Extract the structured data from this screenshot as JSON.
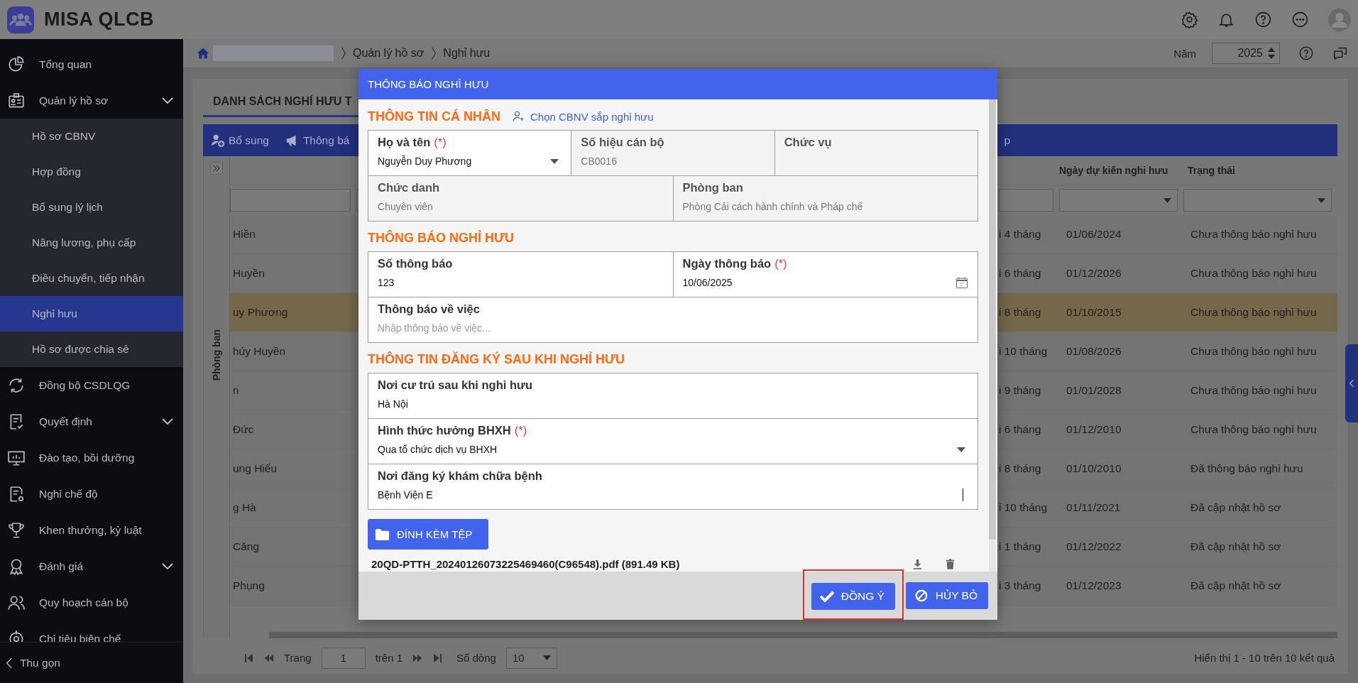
{
  "app": {
    "title": "MISA QLCB"
  },
  "sidebar": {
    "items": [
      {
        "label": "Tổng quan",
        "selected": false
      },
      {
        "label": "Quản lý hồ sơ",
        "selected": false,
        "expandable": true,
        "expanded": true,
        "children": [
          {
            "label": "Hồ sơ CBNV",
            "selected": false
          },
          {
            "label": "Hợp đồng",
            "selected": false
          },
          {
            "label": "Bổ sung lý lịch",
            "selected": false
          },
          {
            "label": "Nâng lương, phụ cấp",
            "selected": false
          },
          {
            "label": "Điều chuyển, tiếp nhận",
            "selected": false
          },
          {
            "label": "Nghỉ hưu",
            "selected": true
          },
          {
            "label": "Hồ sơ được chia sẻ",
            "selected": false
          }
        ]
      },
      {
        "label": "Đồng bộ CSDLQG",
        "selected": false
      },
      {
        "label": "Quyết định",
        "selected": false,
        "expandable": true
      },
      {
        "label": "Đào tạo, bồi dưỡng",
        "selected": false
      },
      {
        "label": "Nghỉ chế độ",
        "selected": false
      },
      {
        "label": "Khen thưởng, kỷ luật",
        "selected": false
      },
      {
        "label": "Đánh giá",
        "selected": false,
        "expandable": true
      },
      {
        "label": "Quy hoạch cán bộ",
        "selected": false
      },
      {
        "label": "Chỉ tiêu biên chế",
        "selected": false
      }
    ],
    "collapse_label": "Thu gọn"
  },
  "breadcrumb": {
    "items": [
      "Quản lý hồ sơ",
      "Nghỉ hưu"
    ]
  },
  "year": {
    "label": "Năm",
    "value": "2025"
  },
  "tab": {
    "label": "DANH SÁCH NGHỈ HƯU T"
  },
  "toolbar": {
    "items": [
      "Bổ sung",
      "Thông bá"
    ],
    "tail": "p"
  },
  "table": {
    "side_panel": "Phòng ban",
    "headers": {
      "retire_date": "Ngày dự kiến nghỉ hưu",
      "status": "Trạng thái"
    },
    "rows": [
      {
        "column_1": "Hiền",
        "column_4": "i 4 tháng",
        "retire_date": "01/06/2024",
        "status": "Chưa thông báo nghỉ hưu",
        "selected": false
      },
      {
        "column_1": "Huyền",
        "column_4": "i 6 tháng",
        "retire_date": "01/12/2026",
        "status": "Chưa thông báo nghỉ hưu",
        "selected": false
      },
      {
        "column_1": "uy Phương",
        "column_4": "i 8 tháng",
        "retire_date": "01/10/2015",
        "status": "Chưa thông báo nghỉ hưu",
        "selected": true
      },
      {
        "column_1": "húy Huyền",
        "column_4": "i 10 tháng",
        "retire_date": "01/08/2026",
        "status": "Chưa thông báo nghỉ hưu",
        "selected": false
      },
      {
        "column_1": "n",
        "column_4": "i 9 tháng",
        "retire_date": "01/01/2028",
        "status": "Chưa thông báo nghỉ hưu",
        "selected": false
      },
      {
        "column_1": "Đức",
        "column_4": "i 6 tháng",
        "retire_date": "01/12/2010",
        "status": "Chưa thông báo nghỉ hưu",
        "selected": false
      },
      {
        "column_1": "ung Hiếu",
        "column_4": "i 8 tháng",
        "retire_date": "01/10/2010",
        "status": "Đã thông báo nghỉ hưu",
        "selected": false
      },
      {
        "column_1": "g Hà",
        "column_4": "i 10 tháng",
        "retire_date": "01/11/2021",
        "status": "Đã cập nhật hồ sơ",
        "selected": false
      },
      {
        "column_1": "Căng",
        "column_4": "i 1 tháng",
        "retire_date": "01/12/2022",
        "status": "Đã cập nhật hồ sơ",
        "selected": false
      },
      {
        "column_1": "Phụng",
        "column_4": "i 3 tháng",
        "retire_date": "01/12/2023",
        "status": "Đã cập nhật hồ sơ",
        "selected": false
      }
    ]
  },
  "pager": {
    "page_label": "Trang",
    "page": "1",
    "of": "trên 1",
    "rows_label": "Số dòng",
    "rows": "10",
    "summary": "Hiển thị 1 - 10 trên 10 kết quả"
  },
  "dialog": {
    "title": "THÔNG BÁO NGHỈ HƯU",
    "sections": [
      {
        "title": "THÔNG TIN CÁ NHÂN",
        "action": "Chọn CBNV sắp nghỉ hưu",
        "rows": [
          {
            "fields": [
              {
                "label": "Họ và tên",
                "required_mark": "(*)",
                "kind": "select",
                "value": "Nguyễn Duy Phương",
                "disabled": false
              },
              {
                "label": "Số hiệu cán bộ",
                "kind": "text",
                "value": "CB0016",
                "disabled": true
              },
              {
                "label": "Chức vụ",
                "kind": "text",
                "disabled": true
              }
            ]
          },
          {
            "fields": [
              {
                "label": "Chức danh",
                "kind": "text",
                "value": "Chuyên viên",
                "disabled": true
              },
              {
                "label": "Phòng ban",
                "kind": "text",
                "value": "Phòng Cải cách hành chính và Pháp chế",
                "disabled": true
              }
            ]
          }
        ]
      },
      {
        "title": "THÔNG BÁO NGHỈ HƯU",
        "rows": [
          {
            "fields": [
              {
                "label": "Số thông báo",
                "kind": "text",
                "value": "123",
                "disabled": false
              },
              {
                "label": "Ngày thông báo",
                "required_mark": "(*)",
                "kind": "date",
                "value": "10/06/2025",
                "disabled": false
              }
            ]
          },
          {
            "fields": [
              {
                "label": "Thông báo về việc",
                "kind": "text",
                "placeholder": "Nhập thông báo về việc...",
                "disabled": false
              }
            ]
          }
        ]
      },
      {
        "title": "THÔNG TIN ĐĂNG KÝ SAU KHI NGHỈ HƯU",
        "rows": [
          {
            "fields": [
              {
                "label": "Nơi cư trú sau khi nghỉ hưu",
                "kind": "text",
                "value": "Hà Nội",
                "disabled": false
              }
            ]
          },
          {
            "fields": [
              {
                "label": "Hình thức hưởng BHXH",
                "required_mark": "(*)",
                "kind": "select",
                "value": "Qua tổ chức dịch vụ BHXH",
                "disabled": false
              }
            ]
          },
          {
            "fields": [
              {
                "label": "Nơi đăng ký khám chữa bệnh",
                "kind": "text",
                "value": "Bệnh Viện E",
                "disabled": false,
                "focused": true
              }
            ]
          }
        ]
      }
    ],
    "attach_button": "ĐÍNH KÈM TỆP",
    "attachments": [
      {
        "name": "20QD-PTTH_20240126073225469460(C96548).pdf (891.49 KB)"
      }
    ],
    "buttons": [
      {
        "label": "ĐỒNG Ý",
        "kind": "confirm",
        "highlighted": true
      },
      {
        "label": "HỦY BỎ",
        "kind": "cancel",
        "highlighted": false
      }
    ]
  }
}
